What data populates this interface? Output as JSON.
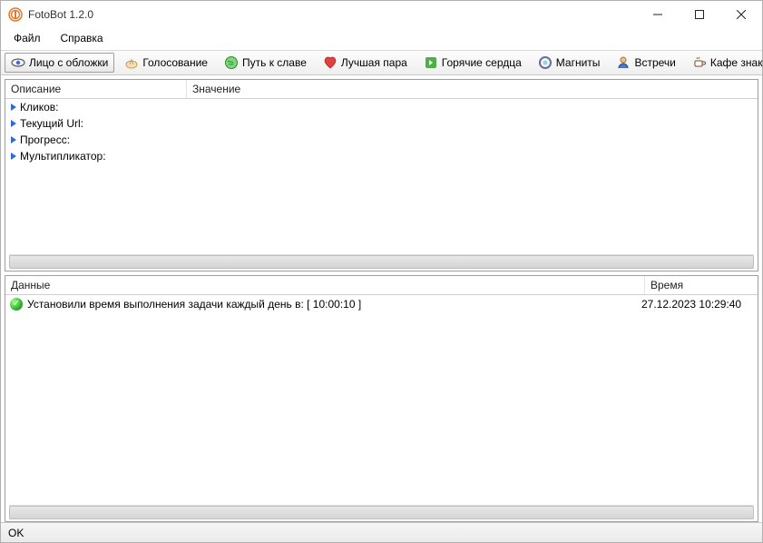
{
  "window": {
    "title": "FotoBot 1.2.0"
  },
  "menu": {
    "file": "Файл",
    "help": "Справка"
  },
  "toolbar": {
    "items": [
      {
        "label": "Лицо с обложки",
        "icon": "eye-icon"
      },
      {
        "label": "Голосование",
        "icon": "thumbs-up-icon"
      },
      {
        "label": "Путь к славе",
        "icon": "globe-icon"
      },
      {
        "label": "Лучшая пара",
        "icon": "heart-icon"
      },
      {
        "label": "Горячие сердца",
        "icon": "flame-icon"
      },
      {
        "label": "Магниты",
        "icon": "magnet-icon"
      },
      {
        "label": "Встречи",
        "icon": "people-icon"
      },
      {
        "label": "Кафе знакомств",
        "icon": "coffee-icon"
      }
    ]
  },
  "topPanel": {
    "col1": "Описание",
    "col2": "Значение",
    "rows": [
      {
        "desc": "Кликов:",
        "val": ""
      },
      {
        "desc": "Текущий Url:",
        "val": ""
      },
      {
        "desc": "Прогресс:",
        "val": ""
      },
      {
        "desc": "Мультипликатор:",
        "val": ""
      }
    ]
  },
  "bottomPanel": {
    "col1": "Данные",
    "col2": "Время",
    "rows": [
      {
        "msg": "Установили время выполнения задачи каждый день в: [ 10:00:10 ]",
        "time": "27.12.2023 10:29:40",
        "icon": "check"
      }
    ]
  },
  "status": {
    "text": "OK"
  }
}
